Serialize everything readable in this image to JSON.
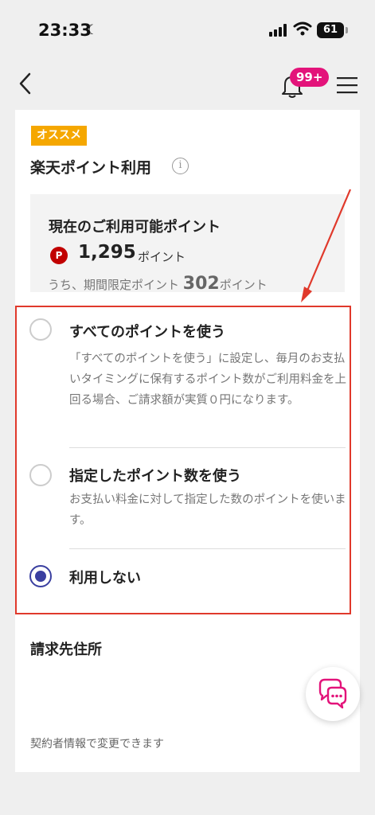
{
  "status_bar": {
    "time": "23:33",
    "battery": "61"
  },
  "nav": {
    "notification_badge": "99+"
  },
  "card": {
    "tag": "オススメ",
    "title": "楽天ポイント利用",
    "info_symbol": "i",
    "points": {
      "label": "現在のご利用可能ポイント",
      "icon_text": "P",
      "value": "1,295",
      "unit": "ポイント",
      "limited_prefix": "うち、期間限定ポイント",
      "limited_value": "302",
      "limited_unit": "ポイント"
    },
    "options": [
      {
        "title": "すべてのポイントを使う",
        "description": "「すべてのポイントを使う」に設定し、毎月のお支払いタイミングに保有するポイント数がご利用料金を上回る場合、ご請求額が実質０円になります。",
        "checked": false
      },
      {
        "title": "指定したポイント数を使う",
        "description": "お支払い料金に対して指定した数のポイントを使います。",
        "checked": false
      },
      {
        "title": "利用しない",
        "description": "",
        "checked": true
      }
    ],
    "address_title": "請求先住所",
    "address_note": "契約者情報で変更できます"
  },
  "colors": {
    "accent": "#3a3fa0",
    "highlight_border": "#e0392b",
    "tag": "#f5a700",
    "badge": "#e3137a",
    "point_icon": "#c10000"
  },
  "icons": {
    "back": "chevron-left-icon",
    "bell": "bell-icon",
    "menu": "hamburger-menu-icon",
    "info": "info-icon",
    "chat": "chat-icon"
  }
}
